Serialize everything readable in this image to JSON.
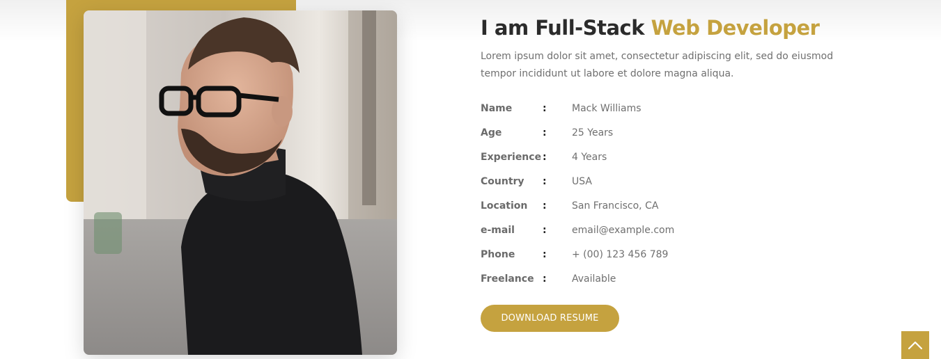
{
  "colors": {
    "accent": "#c5a23f",
    "heading": "#2b2b2b",
    "text": "#6f6f6f"
  },
  "about": {
    "heading_prefix": "I am Full-Stack ",
    "heading_highlight": "Web Developer",
    "intro": "Lorem ipsum dolor sit amet, consectetur adipiscing elit, sed do eiusmod tempor incididunt ut labore et dolore magna aliqua.",
    "separator": ":",
    "info": [
      {
        "label": "Name",
        "value": "Mack Williams"
      },
      {
        "label": "Age",
        "value": "25 Years"
      },
      {
        "label": "Experience",
        "value": "4 Years"
      },
      {
        "label": "Country",
        "value": "USA"
      },
      {
        "label": "Location",
        "value": "San Francisco, CA"
      },
      {
        "label": "e-mail",
        "value": "email@example.com"
      },
      {
        "label": "Phone",
        "value": "+ (00) 123 456 789"
      },
      {
        "label": "Freelance",
        "value": "Available"
      }
    ],
    "download_label": "DOWNLOAD RESUME"
  },
  "icons": {
    "scroll_top": "chevron-up-icon"
  }
}
